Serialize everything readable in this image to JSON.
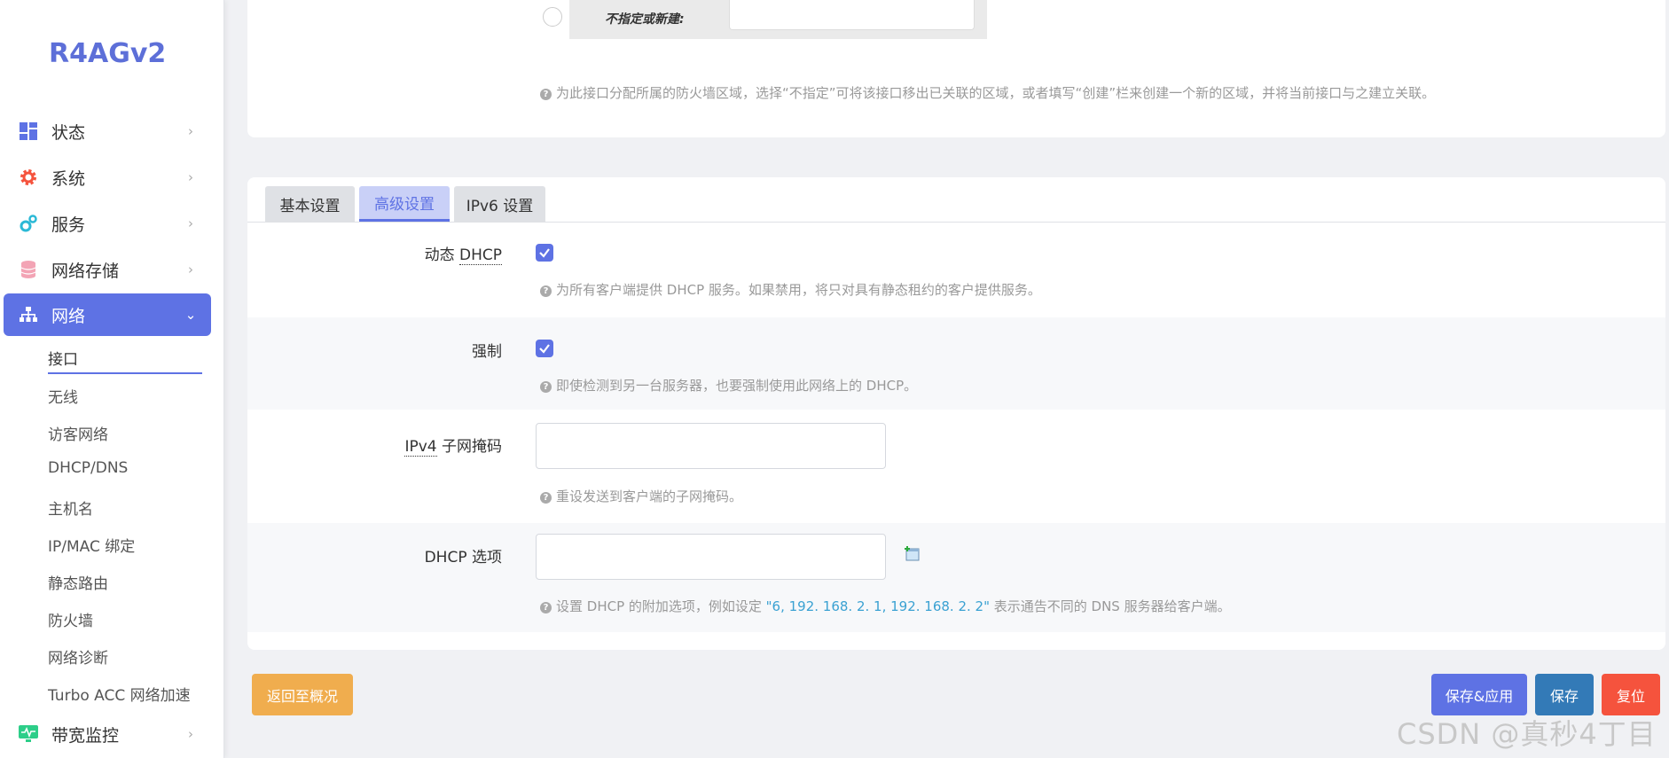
{
  "sidebar": {
    "logo": "R4AGv2",
    "menu": [
      {
        "label": "状态",
        "icon": "dashboard-icon"
      },
      {
        "label": "系统",
        "icon": "gear-icon"
      },
      {
        "label": "服务",
        "icon": "gears-icon"
      },
      {
        "label": "网络存储",
        "icon": "database-icon"
      },
      {
        "label": "网络",
        "icon": "network-icon"
      },
      {
        "label": "带宽监控",
        "icon": "monitor-icon"
      }
    ],
    "submenu": [
      "接口",
      "无线",
      "访客网络",
      "DHCP/DNS",
      "主机名",
      "IP/MAC 绑定",
      "静态路由",
      "防火墙",
      "网络诊断",
      "Turbo ACC 网络加速"
    ]
  },
  "firewall_zone": {
    "option_label": "不指定或新建:",
    "help": "为此接口分配所属的防火墙区域，选择“不指定”可将该接口移出已关联的区域，或者填写“创建”栏来创建一个新的区域，并将当前接口与之建立关联。"
  },
  "tabs": [
    "基本设置",
    "高级设置",
    "IPv6 设置"
  ],
  "fields": {
    "dynamic_dhcp": {
      "label_pre": "动态 ",
      "label_abbr": "DHCP",
      "checked": true,
      "help": "为所有客户端提供 DHCP 服务。如果禁用，将只对具有静态租约的客户提供服务。"
    },
    "force": {
      "label": "强制",
      "checked": true,
      "help": "即使检测到另一台服务器，也要强制使用此网络上的 DHCP。"
    },
    "ipv4_netmask": {
      "label_abbr": "IPv4",
      "label_post": " 子网掩码",
      "value": "",
      "help": "重设发送到客户端的子网掩码。"
    },
    "dhcp_options": {
      "label": "DHCP 选项",
      "value": "",
      "help_pre": "设置 DHCP 的附加选项，例如设定 ",
      "help_example": "\"6, 192. 168. 2. 1, 192. 168. 2. 2\"",
      "help_post": " 表示通告不同的 DNS 服务器给客户端。"
    }
  },
  "buttons": {
    "back": "返回至概况",
    "save_apply": "保存&应用",
    "save": "保存",
    "reset": "复位"
  },
  "colors": {
    "accent": "#5e72e4",
    "back_button": "#f0ad4e",
    "save_apply_button": "#5e72e4",
    "save_button": "#337ab7",
    "reset_button": "#f5533d"
  },
  "watermark": "CSDN @真秒4丁目"
}
